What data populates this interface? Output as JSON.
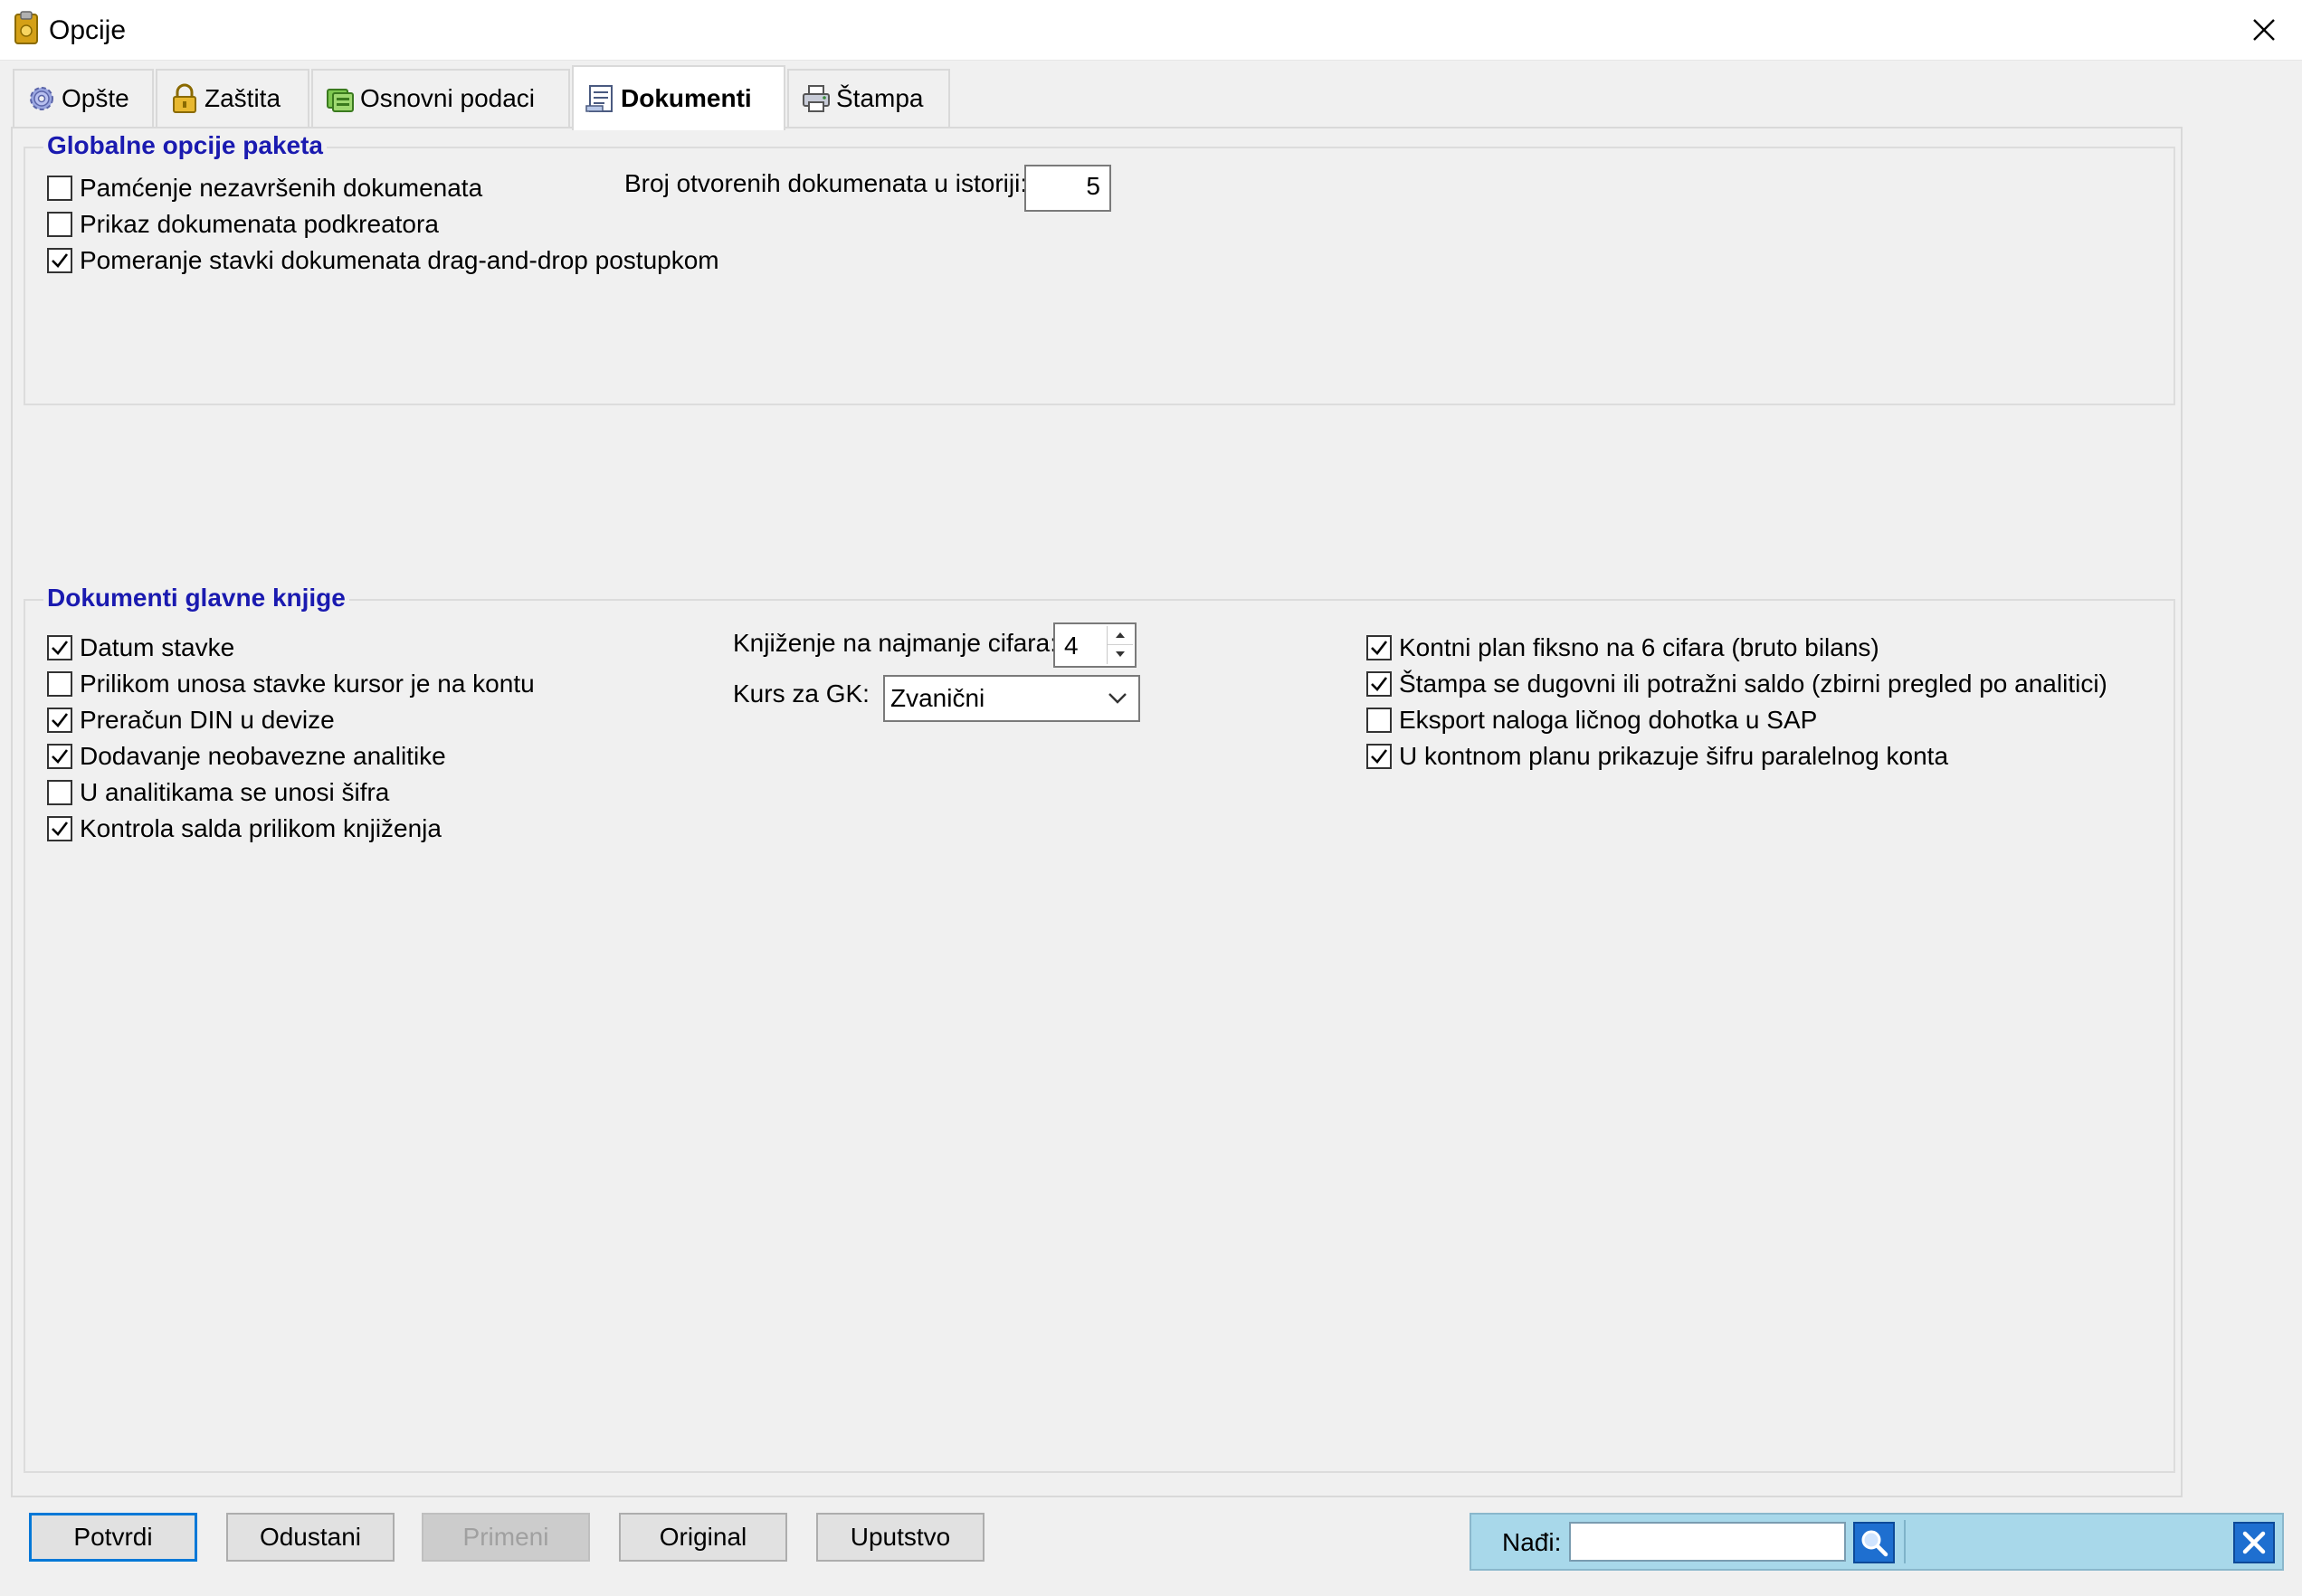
{
  "window": {
    "title": "Opcije"
  },
  "tabs": [
    {
      "label": "Opšte",
      "icon": "gear-icon",
      "active": false
    },
    {
      "label": "Zaštita",
      "icon": "lock-icon",
      "active": false
    },
    {
      "label": "Osnovni podaci",
      "icon": "database-icon",
      "active": false
    },
    {
      "label": "Dokumenti",
      "icon": "document-icon",
      "active": true
    },
    {
      "label": "Štampa",
      "icon": "printer-icon",
      "active": false
    }
  ],
  "global_options": {
    "title": "Globalne opcije paketa",
    "checkboxes": [
      {
        "label": "Pamćenje nezavršenih dokumenata",
        "checked": false
      },
      {
        "label": "Prikaz dokumenata podkreatora",
        "checked": false
      },
      {
        "label": "Pomeranje stavki dokumenata drag-and-drop postupkom",
        "checked": true
      }
    ],
    "history_label": "Broj otvorenih dokumenata u istoriji:",
    "history_value": "5"
  },
  "gk_documents": {
    "title": "Dokumenti glavne knjige",
    "left_checkboxes": [
      {
        "label": "Datum stavke",
        "checked": true
      },
      {
        "label": "Prilikom unosa stavke kursor je na kontu",
        "checked": false
      },
      {
        "label": "Preračun DIN u devize",
        "checked": true
      },
      {
        "label": "Dodavanje neobavezne analitike",
        "checked": true
      },
      {
        "label": "U analitikama se unosi šifra",
        "checked": false
      },
      {
        "label": "Kontrola salda prilikom knjiženja",
        "checked": true
      }
    ],
    "digits_label": "Knjiženje na najmanje cifara:",
    "digits_value": "4",
    "rate_label": "Kurs za GK:",
    "rate_value": "Zvanični",
    "right_checkboxes": [
      {
        "label": "Kontni plan fiksno na 6 cifara (bruto bilans)",
        "checked": true
      },
      {
        "label": "Štampa se dugovni ili potražni saldo (zbirni pregled po analitici)",
        "checked": true
      },
      {
        "label": "Eksport naloga ličnog dohotka u SAP",
        "checked": false
      },
      {
        "label": "U kontnom planu prikazuje šifru paralelnog konta",
        "checked": true
      }
    ]
  },
  "buttons": {
    "confirm": "Potvrdi",
    "cancel": "Odustani",
    "apply": "Primeni",
    "original": "Original",
    "help": "Uputstvo"
  },
  "find": {
    "label": "Nađi:",
    "value": ""
  },
  "colors": {
    "group_title": "#1a1ab0",
    "find_bar": "#a8d8ea",
    "accent": "#0078d7"
  }
}
